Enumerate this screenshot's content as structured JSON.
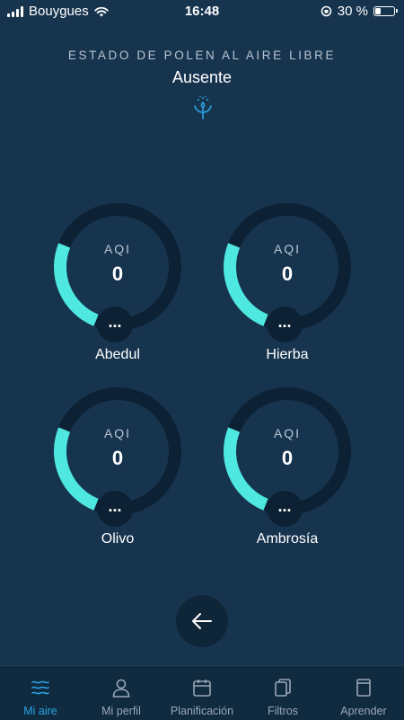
{
  "status_bar": {
    "carrier": "Bouygues",
    "time": "16:48",
    "battery": "30 %",
    "battery_level": 0.3
  },
  "header": {
    "subtitle": "ESTADO DE POLEN AL AIRE LIBRE",
    "status": "Ausente",
    "icon": "pollen-icon"
  },
  "gauges": [
    {
      "metric_label": "AQI",
      "value": "0",
      "name": "Abedul",
      "menu": "..."
    },
    {
      "metric_label": "AQI",
      "value": "0",
      "name": "Hierba",
      "menu": "..."
    },
    {
      "metric_label": "AQI",
      "value": "0",
      "name": "Olivo",
      "menu": "..."
    },
    {
      "metric_label": "AQI",
      "value": "0",
      "name": "Ambrosía",
      "menu": "..."
    }
  ],
  "colors": {
    "background": "#17344f",
    "ring_track": "#0c2133",
    "ring_fill": "#4ee8e0",
    "active_tab": "#2aa4e2"
  },
  "back_button": {
    "icon": "arrow-left-icon"
  },
  "tab_bar": {
    "tabs": [
      {
        "label": "Mi aire",
        "icon": "waves-icon",
        "active": true
      },
      {
        "label": "Mi perfil",
        "icon": "user-icon",
        "active": false
      },
      {
        "label": "Planificación",
        "icon": "calendar-icon",
        "active": false
      },
      {
        "label": "Filtros",
        "icon": "filters-icon",
        "active": false
      },
      {
        "label": "Aprender",
        "icon": "book-icon",
        "active": false
      }
    ]
  }
}
